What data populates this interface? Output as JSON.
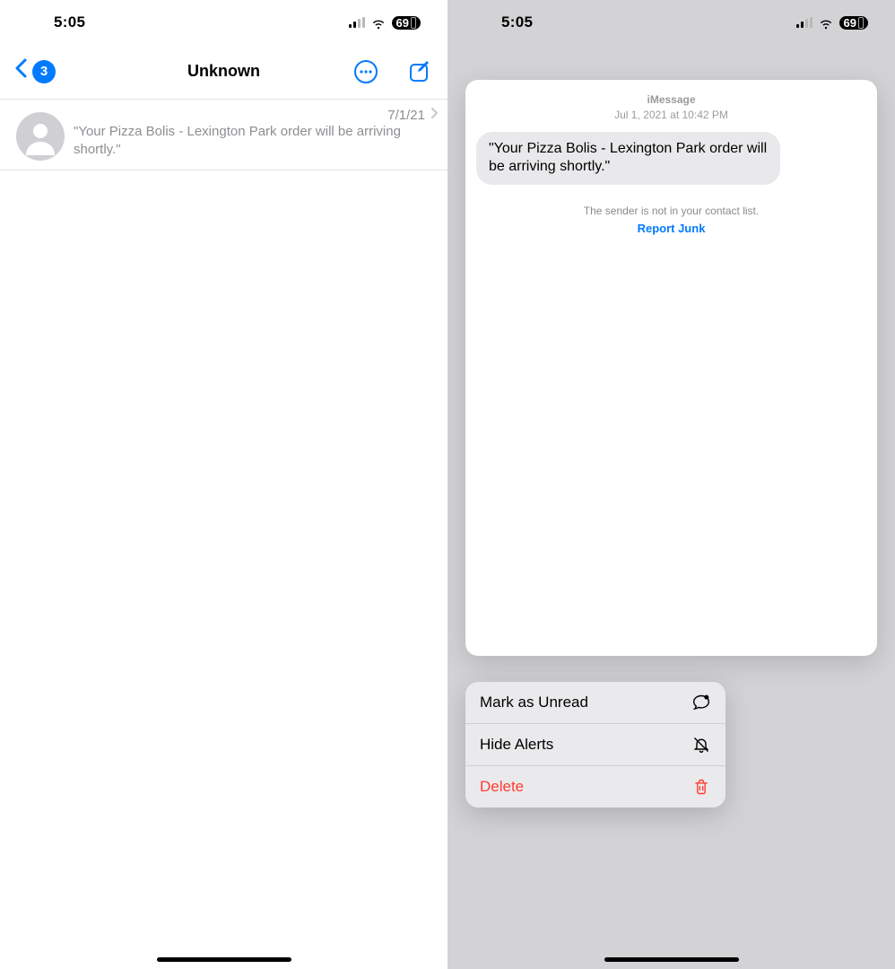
{
  "status": {
    "time": "5:05",
    "battery": "69"
  },
  "left": {
    "title": "Unknown",
    "back_badge": "3",
    "conv": {
      "date": "7/1/21",
      "preview": "\"Your Pizza Bolis - Lexington Park order will be arriving shortly.\""
    }
  },
  "right": {
    "card": {
      "service": "iMessage",
      "timestamp": "Jul 1, 2021 at 10:42 PM",
      "message": "\"Your Pizza Bolis - Lexington Park order will be arriving shortly.\"",
      "warning": "The sender is not in your contact list.",
      "report_link": "Report Junk"
    },
    "menu": {
      "mark_unread": "Mark as Unread",
      "hide_alerts": "Hide Alerts",
      "delete": "Delete"
    }
  }
}
